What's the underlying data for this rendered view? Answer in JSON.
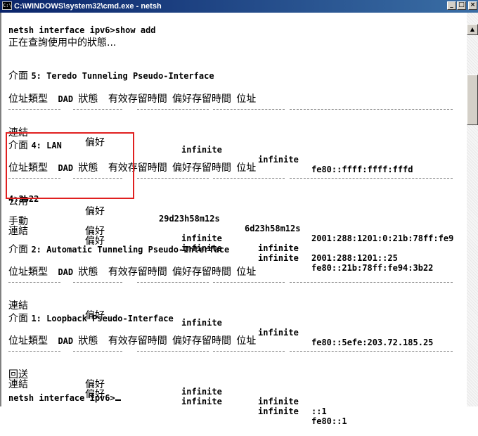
{
  "window": {
    "title": "C:\\WINDOWS\\system32\\cmd.exe - netsh",
    "icon": "cmd-icon"
  },
  "window_buttons": {
    "minimize": "_",
    "maximize": "□",
    "close": "×"
  },
  "console": {
    "cmd_prompt": "netsh interface ipv6>show add",
    "querying": "正在查詢使用中的狀態...",
    "if5": {
      "cjk": "介面 ",
      "rest": "5: Teredo Tunneling Pseudo-Interface"
    },
    "header": {
      "c1": "位址類型",
      "c2a": "DAD ",
      "c2b": "狀態",
      "c3": "有效存留時間",
      "c4": "偏好存留時間",
      "c5": "位址"
    },
    "if5_row1": {
      "type": "連結",
      "dad": "偏好",
      "valid": "infinite",
      "pref": "infinite",
      "addr": "fe80::ffff:ffff:fffd"
    },
    "if4": {
      "cjk": "介面 ",
      "rest": "4: LAN"
    },
    "if4_row1": {
      "type": "公用",
      "dad": "偏好",
      "valid": "29d23h58m12s",
      "pref": "6d23h58m12s",
      "addr": "2001:288:1201:0:21b:78ff:fe9"
    },
    "if4_row1_wrap": "4:3b22",
    "if4_row2": {
      "type": "手動",
      "dad": "偏好",
      "valid": "infinite",
      "pref": "infinite",
      "addr": "2001:288:1201::25"
    },
    "if4_row3": {
      "type": "連結",
      "dad": "偏好",
      "valid": "infinite",
      "pref": "infinite",
      "addr": "fe80::21b:78ff:fe94:3b22"
    },
    "if2": {
      "cjk": "介面 ",
      "rest": "2: Automatic Tunneling Pseudo-Interface"
    },
    "if2_row1": {
      "type": "連結",
      "dad": "偏好",
      "valid": "infinite",
      "pref": "infinite",
      "addr": "fe80::5efe:203.72.185.25"
    },
    "if1": {
      "cjk": "介面 ",
      "rest": "1: Loopback Pseudo-Interface"
    },
    "if1_row1": {
      "type": "回送",
      "dad": "偏好",
      "valid": "infinite",
      "pref": "infinite",
      "addr": "::1"
    },
    "if1_row2": {
      "type": "連結",
      "dad": "偏好",
      "valid": "infinite",
      "pref": "infinite",
      "addr": "fe80::1"
    },
    "final_prompt": "netsh interface ipv6>"
  },
  "colors": {
    "highlight": "#e02020",
    "titlebar": "#0a246a"
  }
}
